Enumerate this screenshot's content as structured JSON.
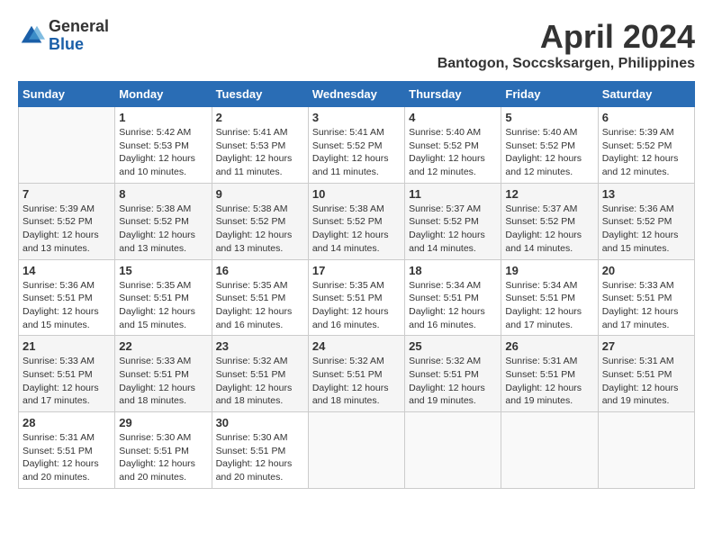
{
  "logo": {
    "general": "General",
    "blue": "Blue"
  },
  "title": {
    "month_year": "April 2024",
    "location": "Bantogon, Soccsksargen, Philippines"
  },
  "days_of_week": [
    "Sunday",
    "Monday",
    "Tuesday",
    "Wednesday",
    "Thursday",
    "Friday",
    "Saturday"
  ],
  "weeks": [
    [
      {
        "day": "",
        "info": ""
      },
      {
        "day": "1",
        "info": "Sunrise: 5:42 AM\nSunset: 5:53 PM\nDaylight: 12 hours\nand 10 minutes."
      },
      {
        "day": "2",
        "info": "Sunrise: 5:41 AM\nSunset: 5:53 PM\nDaylight: 12 hours\nand 11 minutes."
      },
      {
        "day": "3",
        "info": "Sunrise: 5:41 AM\nSunset: 5:52 PM\nDaylight: 12 hours\nand 11 minutes."
      },
      {
        "day": "4",
        "info": "Sunrise: 5:40 AM\nSunset: 5:52 PM\nDaylight: 12 hours\nand 12 minutes."
      },
      {
        "day": "5",
        "info": "Sunrise: 5:40 AM\nSunset: 5:52 PM\nDaylight: 12 hours\nand 12 minutes."
      },
      {
        "day": "6",
        "info": "Sunrise: 5:39 AM\nSunset: 5:52 PM\nDaylight: 12 hours\nand 12 minutes."
      }
    ],
    [
      {
        "day": "7",
        "info": "Sunrise: 5:39 AM\nSunset: 5:52 PM\nDaylight: 12 hours\nand 13 minutes."
      },
      {
        "day": "8",
        "info": "Sunrise: 5:38 AM\nSunset: 5:52 PM\nDaylight: 12 hours\nand 13 minutes."
      },
      {
        "day": "9",
        "info": "Sunrise: 5:38 AM\nSunset: 5:52 PM\nDaylight: 12 hours\nand 13 minutes."
      },
      {
        "day": "10",
        "info": "Sunrise: 5:38 AM\nSunset: 5:52 PM\nDaylight: 12 hours\nand 14 minutes."
      },
      {
        "day": "11",
        "info": "Sunrise: 5:37 AM\nSunset: 5:52 PM\nDaylight: 12 hours\nand 14 minutes."
      },
      {
        "day": "12",
        "info": "Sunrise: 5:37 AM\nSunset: 5:52 PM\nDaylight: 12 hours\nand 14 minutes."
      },
      {
        "day": "13",
        "info": "Sunrise: 5:36 AM\nSunset: 5:52 PM\nDaylight: 12 hours\nand 15 minutes."
      }
    ],
    [
      {
        "day": "14",
        "info": "Sunrise: 5:36 AM\nSunset: 5:51 PM\nDaylight: 12 hours\nand 15 minutes."
      },
      {
        "day": "15",
        "info": "Sunrise: 5:35 AM\nSunset: 5:51 PM\nDaylight: 12 hours\nand 15 minutes."
      },
      {
        "day": "16",
        "info": "Sunrise: 5:35 AM\nSunset: 5:51 PM\nDaylight: 12 hours\nand 16 minutes."
      },
      {
        "day": "17",
        "info": "Sunrise: 5:35 AM\nSunset: 5:51 PM\nDaylight: 12 hours\nand 16 minutes."
      },
      {
        "day": "18",
        "info": "Sunrise: 5:34 AM\nSunset: 5:51 PM\nDaylight: 12 hours\nand 16 minutes."
      },
      {
        "day": "19",
        "info": "Sunrise: 5:34 AM\nSunset: 5:51 PM\nDaylight: 12 hours\nand 17 minutes."
      },
      {
        "day": "20",
        "info": "Sunrise: 5:33 AM\nSunset: 5:51 PM\nDaylight: 12 hours\nand 17 minutes."
      }
    ],
    [
      {
        "day": "21",
        "info": "Sunrise: 5:33 AM\nSunset: 5:51 PM\nDaylight: 12 hours\nand 17 minutes."
      },
      {
        "day": "22",
        "info": "Sunrise: 5:33 AM\nSunset: 5:51 PM\nDaylight: 12 hours\nand 18 minutes."
      },
      {
        "day": "23",
        "info": "Sunrise: 5:32 AM\nSunset: 5:51 PM\nDaylight: 12 hours\nand 18 minutes."
      },
      {
        "day": "24",
        "info": "Sunrise: 5:32 AM\nSunset: 5:51 PM\nDaylight: 12 hours\nand 18 minutes."
      },
      {
        "day": "25",
        "info": "Sunrise: 5:32 AM\nSunset: 5:51 PM\nDaylight: 12 hours\nand 19 minutes."
      },
      {
        "day": "26",
        "info": "Sunrise: 5:31 AM\nSunset: 5:51 PM\nDaylight: 12 hours\nand 19 minutes."
      },
      {
        "day": "27",
        "info": "Sunrise: 5:31 AM\nSunset: 5:51 PM\nDaylight: 12 hours\nand 19 minutes."
      }
    ],
    [
      {
        "day": "28",
        "info": "Sunrise: 5:31 AM\nSunset: 5:51 PM\nDaylight: 12 hours\nand 20 minutes."
      },
      {
        "day": "29",
        "info": "Sunrise: 5:30 AM\nSunset: 5:51 PM\nDaylight: 12 hours\nand 20 minutes."
      },
      {
        "day": "30",
        "info": "Sunrise: 5:30 AM\nSunset: 5:51 PM\nDaylight: 12 hours\nand 20 minutes."
      },
      {
        "day": "",
        "info": ""
      },
      {
        "day": "",
        "info": ""
      },
      {
        "day": "",
        "info": ""
      },
      {
        "day": "",
        "info": ""
      }
    ]
  ]
}
